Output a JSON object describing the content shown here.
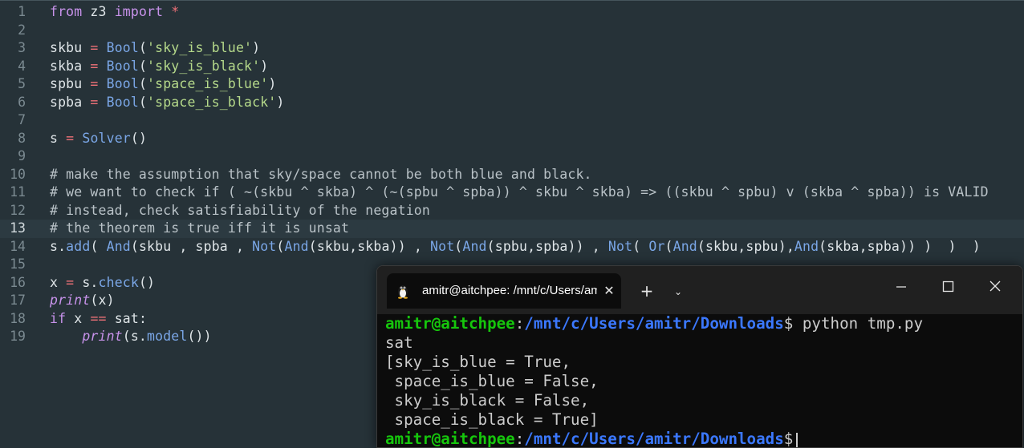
{
  "editor": {
    "active_line": 13,
    "line_numbers": [
      "1",
      "2",
      "3",
      "4",
      "5",
      "6",
      "7",
      "8",
      "9",
      "10",
      "11",
      "12",
      "13",
      "14",
      "15",
      "16",
      "17",
      "18",
      "19"
    ],
    "lines": [
      [
        [
          "kw",
          "from"
        ],
        [
          "pl",
          " z3 "
        ],
        [
          "kw",
          "import"
        ],
        [
          "pl",
          " "
        ],
        [
          "op",
          "*"
        ]
      ],
      [],
      [
        [
          "pl",
          "skbu "
        ],
        [
          "op",
          "="
        ],
        [
          "pl",
          " "
        ],
        [
          "fn",
          "Bool"
        ],
        [
          "pl",
          "("
        ],
        [
          "str",
          "'sky_is_blue'"
        ],
        [
          "pl",
          ")"
        ]
      ],
      [
        [
          "pl",
          "skba "
        ],
        [
          "op",
          "="
        ],
        [
          "pl",
          " "
        ],
        [
          "fn",
          "Bool"
        ],
        [
          "pl",
          "("
        ],
        [
          "str",
          "'sky_is_black'"
        ],
        [
          "pl",
          ")"
        ]
      ],
      [
        [
          "pl",
          "spbu "
        ],
        [
          "op",
          "="
        ],
        [
          "pl",
          " "
        ],
        [
          "fn",
          "Bool"
        ],
        [
          "pl",
          "("
        ],
        [
          "str",
          "'space_is_blue'"
        ],
        [
          "pl",
          ")"
        ]
      ],
      [
        [
          "pl",
          "spba "
        ],
        [
          "op",
          "="
        ],
        [
          "pl",
          " "
        ],
        [
          "fn",
          "Bool"
        ],
        [
          "pl",
          "("
        ],
        [
          "str",
          "'space_is_black'"
        ],
        [
          "pl",
          ")"
        ]
      ],
      [],
      [
        [
          "pl",
          "s "
        ],
        [
          "op",
          "="
        ],
        [
          "pl",
          " "
        ],
        [
          "fn",
          "Solver"
        ],
        [
          "pl",
          "()"
        ]
      ],
      [],
      [
        [
          "cm",
          "# make the assumption that sky/space cannot be both blue and black."
        ]
      ],
      [
        [
          "cm",
          "# we want to check if ( ~(skbu ^ skba) ^ (~(spbu ^ spba)) ^ skbu ^ skba) => ((skbu ^ spbu) v (skba ^ spba)) is VALID"
        ]
      ],
      [
        [
          "cm",
          "# instead, check satisfiability of the negation"
        ]
      ],
      [
        [
          "cm",
          "# the theorem is true iff it is unsat"
        ]
      ],
      [
        [
          "pl",
          "s."
        ],
        [
          "fn",
          "add"
        ],
        [
          "pl",
          "( "
        ],
        [
          "fn",
          "And"
        ],
        [
          "pl",
          "(skbu , spba , "
        ],
        [
          "fn",
          "Not"
        ],
        [
          "pl",
          "("
        ],
        [
          "fn",
          "And"
        ],
        [
          "pl",
          "(skbu,skba)) , "
        ],
        [
          "fn",
          "Not"
        ],
        [
          "pl",
          "("
        ],
        [
          "fn",
          "And"
        ],
        [
          "pl",
          "(spbu,spba)) , "
        ],
        [
          "fn",
          "Not"
        ],
        [
          "pl",
          "( "
        ],
        [
          "fn",
          "Or"
        ],
        [
          "pl",
          "("
        ],
        [
          "fn",
          "And"
        ],
        [
          "pl",
          "(skbu,spbu),"
        ],
        [
          "fn",
          "And"
        ],
        [
          "pl",
          "(skba,spba)) )  )  )"
        ]
      ],
      [],
      [
        [
          "pl",
          "x "
        ],
        [
          "op",
          "="
        ],
        [
          "pl",
          " s."
        ],
        [
          "fn",
          "check"
        ],
        [
          "pl",
          "()"
        ]
      ],
      [
        [
          "it",
          "print"
        ],
        [
          "pl",
          "(x)"
        ]
      ],
      [
        [
          "kw",
          "if"
        ],
        [
          "pl",
          " x "
        ],
        [
          "op",
          "=="
        ],
        [
          "pl",
          " sat:"
        ]
      ],
      [
        [
          "pl",
          "    "
        ],
        [
          "it",
          "print"
        ],
        [
          "pl",
          "(s."
        ],
        [
          "fn",
          "model"
        ],
        [
          "pl",
          "())"
        ]
      ]
    ]
  },
  "terminal": {
    "tab_title": "amitr@aitchpee: /mnt/c/Users/amitr/Downloads",
    "tab_icon": "linux-tux-icon",
    "close_tab_label": "✕",
    "new_tab_label": "+",
    "dropdown_label": "⌄",
    "prompt": {
      "user_host": "amitr@aitchpee",
      "path": "/mnt/c/Users/amitr/Downloads",
      "symbol": "$"
    },
    "command": " python tmp.py",
    "output": [
      "sat",
      "[sky_is_blue = True,",
      " space_is_blue = False,",
      " sky_is_black = False,",
      " space_is_black = True]"
    ]
  },
  "colors": {
    "editor_bg": "#263238",
    "keyword": "#c792ea",
    "function": "#7aa6e6",
    "string": "#b5d98a",
    "operator": "#f07178",
    "terminal_bg": "#0c0c0c",
    "prompt_user": "#16c60c",
    "prompt_path": "#3b78ff"
  }
}
